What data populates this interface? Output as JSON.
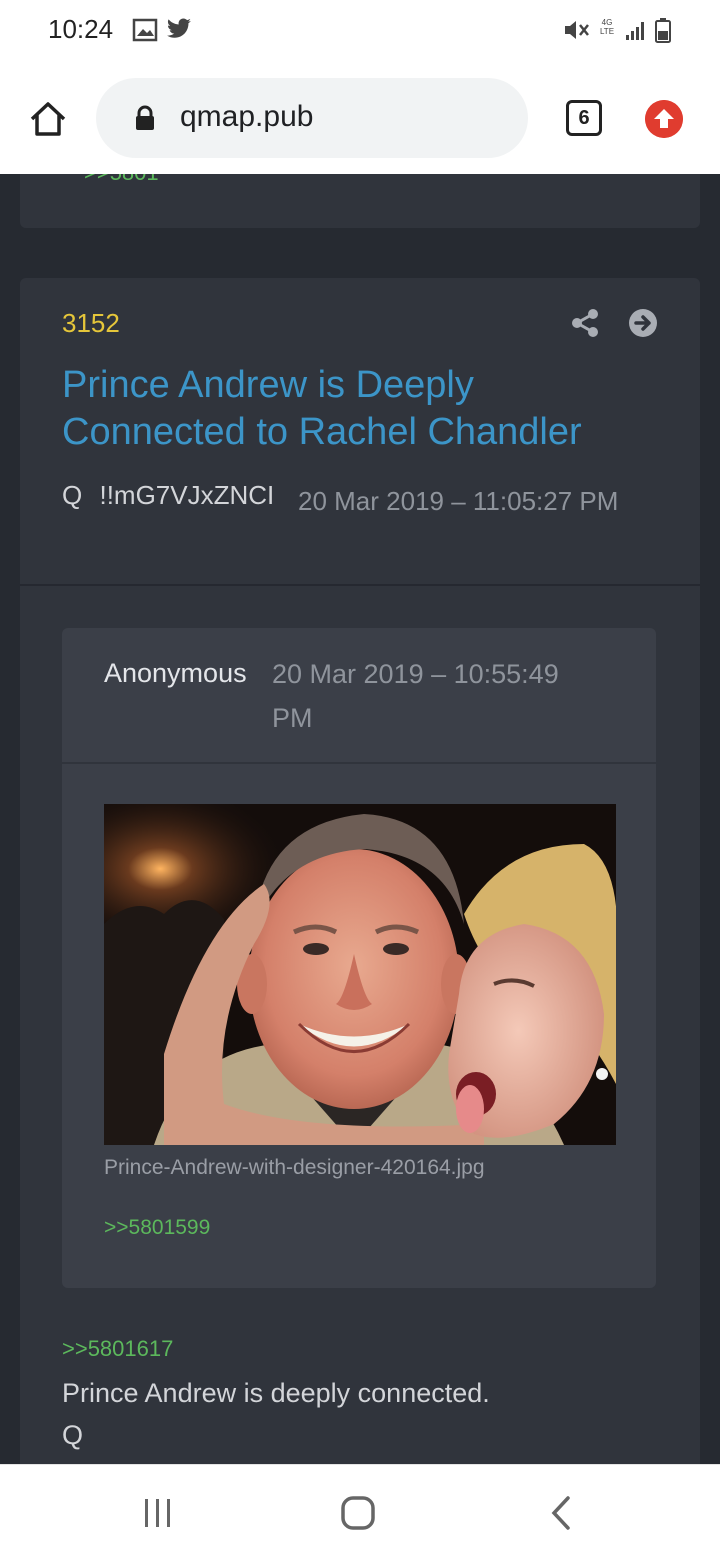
{
  "status_bar": {
    "time": "10:24",
    "network": "4G LTE",
    "icons": [
      "gallery-icon",
      "twitter-icon",
      "mute-icon",
      "signal-icon",
      "battery-icon"
    ]
  },
  "browser": {
    "url": "qmap.pub",
    "tab_count": "6",
    "icons": [
      "home-icon",
      "lock-icon",
      "upload-icon"
    ]
  },
  "post": {
    "number": "3152",
    "title": "Prince Andrew is Deeply Connected to Rachel Chandler",
    "author": "Q",
    "tripcode": "!!mG7VJxZNCI",
    "datetime": "20 Mar 2019 – 11:05:27 PM",
    "quote": {
      "author": "Anonymous",
      "datetime": "20 Mar 2019 – 10:55:49 PM",
      "image_filename": "Prince-Andrew-with-designer-420164.jpg",
      "reply_ref": ">>5801599"
    },
    "reply_ref": ">>5801617",
    "text": "Prince Andrew is deeply connected.",
    "signature": "Q"
  },
  "colors": {
    "background": "#262a31",
    "card": "#30343c",
    "quote_card": "#3b3f48",
    "post_number": "#e5c63a",
    "title": "#3c95c8",
    "reply_link": "#5cb85c",
    "upload_button": "#e03c2f"
  }
}
